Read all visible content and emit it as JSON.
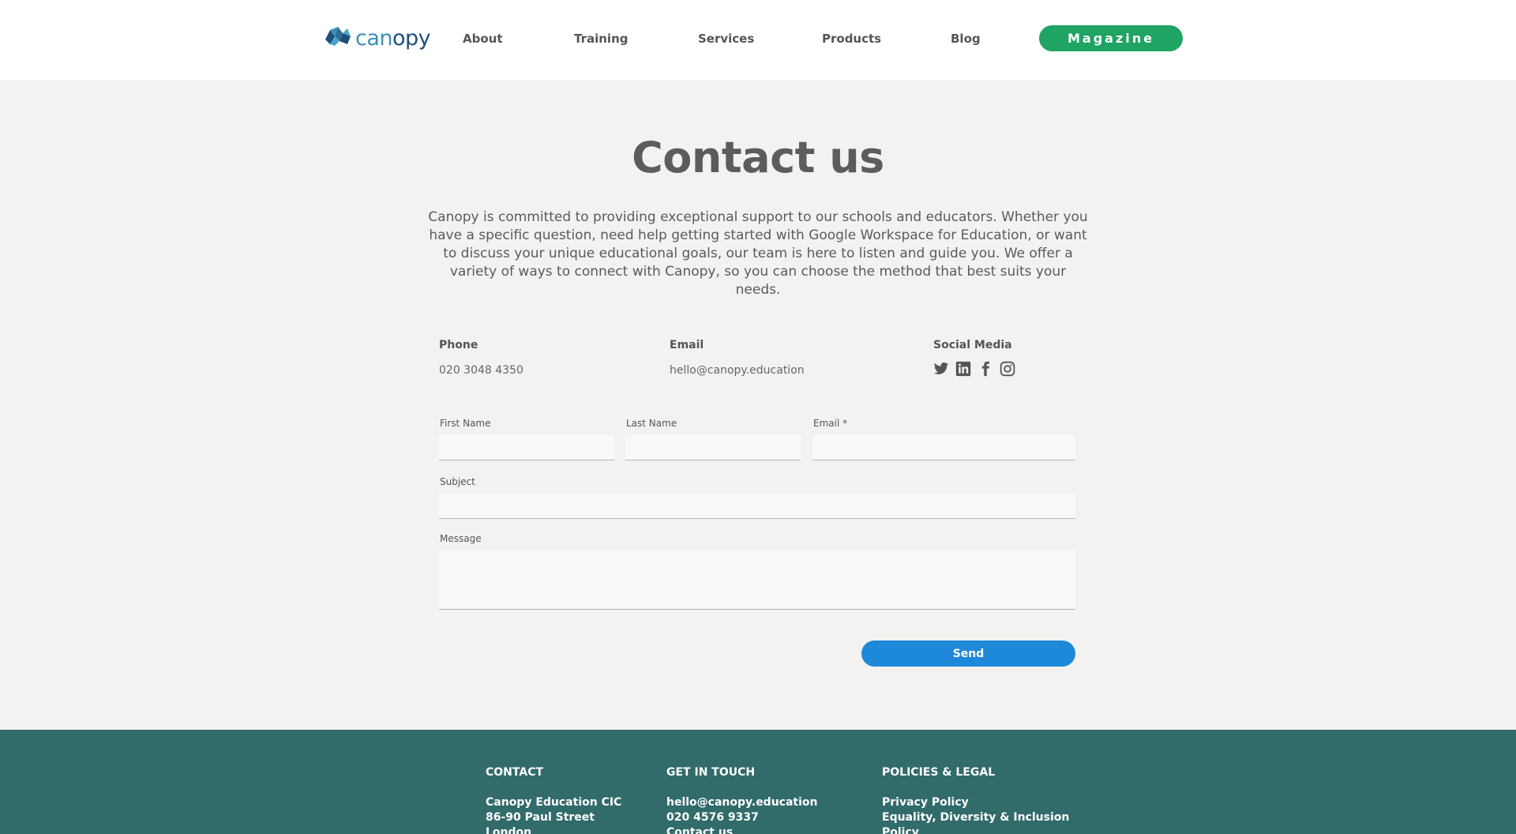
{
  "header": {
    "logo": {
      "part1": "can",
      "part2": "opy"
    },
    "nav": [
      "About",
      "Training",
      "Services",
      "Products",
      "Blog"
    ],
    "cta_label": "Magazine",
    "accent_color": "#1fa463"
  },
  "main": {
    "title": "Contact us",
    "intro": "Canopy is committed to providing exceptional support to our schools and educators. Whether you have a specific question, need help getting started with Google Workspace for Education, or want to discuss your unique educational goals, our team is here to listen and guide you. We offer a variety of ways to connect with Canopy, so you can choose the method that best suits your needs.",
    "phone": {
      "label": "Phone",
      "value": "020 3048 4350"
    },
    "email": {
      "label": "Email",
      "value": "hello@canopy.education"
    },
    "social": {
      "label": "Social Media",
      "icons": [
        "twitter-icon",
        "linkedin-icon",
        "facebook-icon",
        "instagram-icon"
      ]
    }
  },
  "form": {
    "first_name_label": "First Name",
    "last_name_label": "Last Name",
    "email_label": "Email *",
    "subject_label": "Subject",
    "message_label": "Message",
    "first_name_value": "",
    "last_name_value": "",
    "email_value": "",
    "subject_value": "",
    "message_value": "",
    "send_label": "Send",
    "send_color": "#1e88d9"
  },
  "footer": {
    "background": "#316b6a",
    "contact": {
      "heading": "CONTACT",
      "lines": [
        "Canopy Education CIC",
        "86-90 Paul Street",
        "London"
      ]
    },
    "get_in_touch": {
      "heading": "GET IN TOUCH",
      "lines": [
        "hello@canopy.education",
        "020 4576 9337",
        "Contact us"
      ]
    },
    "policies": {
      "heading": "POLICIES & LEGAL",
      "lines": [
        "Privacy Policy",
        "Equality, Diversity & Inclusion",
        "Policy"
      ]
    }
  }
}
